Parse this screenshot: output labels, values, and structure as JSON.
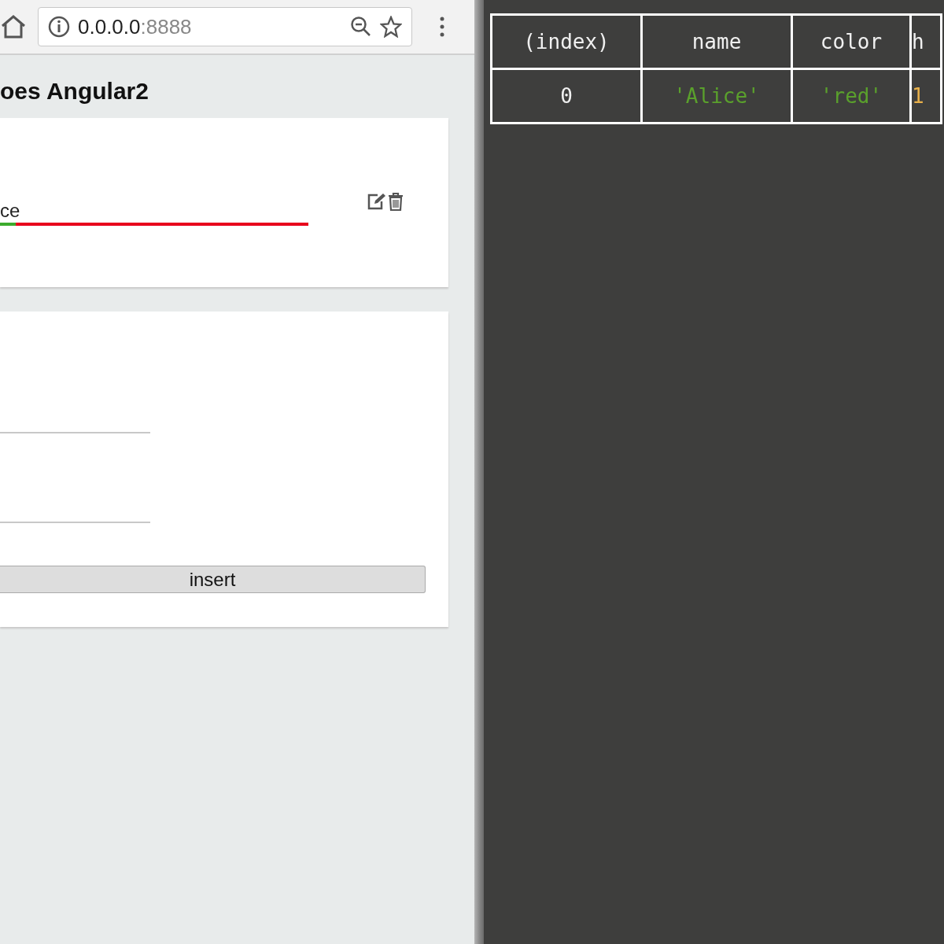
{
  "browser": {
    "address_host": "0.0.0.0",
    "address_port": ":8888"
  },
  "page": {
    "heading": "oes Angular2",
    "item": {
      "name": "ce",
      "level": 0.05
    },
    "form": {
      "button": "insert"
    }
  },
  "console_table": {
    "columns": [
      "(index)",
      "name",
      "color",
      "h"
    ],
    "rows": [
      [
        "0",
        "'Alice'",
        "'red'",
        "1"
      ]
    ]
  }
}
